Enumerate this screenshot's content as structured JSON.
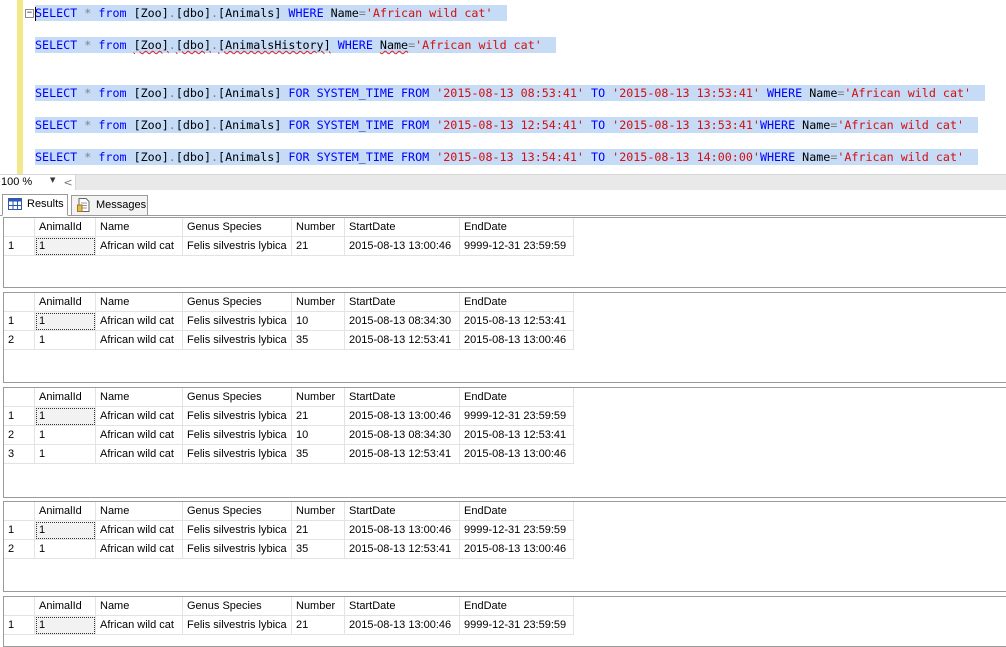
{
  "editor": {
    "queries": [
      {
        "parts": [
          {
            "t": "kw",
            "v": "SELECT"
          },
          {
            "t": "id",
            "v": " "
          },
          {
            "t": "op",
            "v": "*"
          },
          {
            "t": "id",
            "v": " "
          },
          {
            "t": "kw",
            "v": "from"
          },
          {
            "t": "id",
            "v": " [Zoo]"
          },
          {
            "t": "op",
            "v": "."
          },
          {
            "t": "id",
            "v": "[dbo]"
          },
          {
            "t": "op",
            "v": "."
          },
          {
            "t": "id",
            "v": "[Animals] "
          },
          {
            "t": "kw",
            "v": "WHERE"
          },
          {
            "t": "id",
            "v": " Name"
          },
          {
            "t": "op",
            "v": "="
          },
          {
            "t": "str",
            "v": "'African wild cat'"
          }
        ]
      },
      {
        "parts": [
          {
            "t": "kw",
            "v": "SELECT"
          },
          {
            "t": "id",
            "v": " "
          },
          {
            "t": "op",
            "v": "*"
          },
          {
            "t": "id",
            "v": " "
          },
          {
            "t": "kw",
            "v": "from"
          },
          {
            "t": "id",
            "v": " "
          },
          {
            "t": "sq",
            "v": "[Zoo]"
          },
          {
            "t": "op",
            "v": "."
          },
          {
            "t": "sq",
            "v": "[dbo]"
          },
          {
            "t": "op",
            "v": "."
          },
          {
            "t": "sq",
            "v": "[AnimalsHistory]"
          },
          {
            "t": "id",
            "v": " "
          },
          {
            "t": "kw",
            "v": "WHERE"
          },
          {
            "t": "id",
            "v": " "
          },
          {
            "t": "sq",
            "v": "Name"
          },
          {
            "t": "op",
            "v": "="
          },
          {
            "t": "str",
            "v": "'African wild cat'"
          }
        ]
      },
      {
        "parts": [
          {
            "t": "kw",
            "v": "SELECT"
          },
          {
            "t": "id",
            "v": " "
          },
          {
            "t": "op",
            "v": "*"
          },
          {
            "t": "id",
            "v": " "
          },
          {
            "t": "kw",
            "v": "from"
          },
          {
            "t": "id",
            "v": " [Zoo]"
          },
          {
            "t": "op",
            "v": "."
          },
          {
            "t": "id",
            "v": "[dbo]"
          },
          {
            "t": "op",
            "v": "."
          },
          {
            "t": "id",
            "v": "[Animals] "
          },
          {
            "t": "kw",
            "v": "FOR SYSTEM_TIME FROM"
          },
          {
            "t": "id",
            "v": " "
          },
          {
            "t": "str",
            "v": "'2015-08-13 08:53:41'"
          },
          {
            "t": "id",
            "v": " "
          },
          {
            "t": "kw",
            "v": "TO"
          },
          {
            "t": "id",
            "v": " "
          },
          {
            "t": "str",
            "v": "'2015-08-13 13:53:41'"
          },
          {
            "t": "id",
            "v": " "
          },
          {
            "t": "kw",
            "v": "WHERE"
          },
          {
            "t": "id",
            "v": " Name"
          },
          {
            "t": "op",
            "v": "="
          },
          {
            "t": "str",
            "v": "'African wild cat'"
          }
        ]
      },
      {
        "parts": [
          {
            "t": "kw",
            "v": "SELECT"
          },
          {
            "t": "id",
            "v": " "
          },
          {
            "t": "op",
            "v": "*"
          },
          {
            "t": "id",
            "v": " "
          },
          {
            "t": "kw",
            "v": "from"
          },
          {
            "t": "id",
            "v": " [Zoo]"
          },
          {
            "t": "op",
            "v": "."
          },
          {
            "t": "id",
            "v": "[dbo]"
          },
          {
            "t": "op",
            "v": "."
          },
          {
            "t": "id",
            "v": "[Animals] "
          },
          {
            "t": "kw",
            "v": "FOR SYSTEM_TIME FROM"
          },
          {
            "t": "id",
            "v": " "
          },
          {
            "t": "str",
            "v": "'2015-08-13 12:54:41'"
          },
          {
            "t": "id",
            "v": " "
          },
          {
            "t": "kw",
            "v": "TO"
          },
          {
            "t": "id",
            "v": " "
          },
          {
            "t": "str",
            "v": "'2015-08-13 13:53:41'"
          },
          {
            "t": "kw",
            "v": "WHERE"
          },
          {
            "t": "id",
            "v": " Name"
          },
          {
            "t": "op",
            "v": "="
          },
          {
            "t": "str",
            "v": "'African wild cat'"
          }
        ]
      },
      {
        "parts": [
          {
            "t": "kw",
            "v": "SELECT"
          },
          {
            "t": "id",
            "v": " "
          },
          {
            "t": "op",
            "v": "*"
          },
          {
            "t": "id",
            "v": " "
          },
          {
            "t": "kw",
            "v": "from"
          },
          {
            "t": "id",
            "v": " [Zoo]"
          },
          {
            "t": "op",
            "v": "."
          },
          {
            "t": "id",
            "v": "[dbo]"
          },
          {
            "t": "op",
            "v": "."
          },
          {
            "t": "id",
            "v": "[Animals] "
          },
          {
            "t": "kw",
            "v": "FOR SYSTEM_TIME FROM"
          },
          {
            "t": "id",
            "v": " "
          },
          {
            "t": "str",
            "v": "'2015-08-13 13:54:41'"
          },
          {
            "t": "id",
            "v": " "
          },
          {
            "t": "kw",
            "v": "TO"
          },
          {
            "t": "id",
            "v": " "
          },
          {
            "t": "str",
            "v": "'2015-08-13 14:00:00'"
          },
          {
            "t": "kw",
            "v": "WHERE"
          },
          {
            "t": "id",
            "v": " Name"
          },
          {
            "t": "op",
            "v": "="
          },
          {
            "t": "str",
            "v": "'African wild cat'"
          }
        ]
      }
    ],
    "fold_symbol": "−"
  },
  "statusbar": {
    "zoom": "100 %",
    "scroll_left": "<"
  },
  "tabs": {
    "results_label": "Results",
    "messages_label": "Messages"
  },
  "grid_columns": [
    "AnimalId",
    "Name",
    "Genus Species",
    "Number",
    "StartDate",
    "EndDate"
  ],
  "result_sets": [
    {
      "rows": [
        {
          "n": "1",
          "cells": [
            "1",
            "African wild cat",
            "Felis silvestris lybica",
            "21",
            "2015-08-13 13:00:46",
            "9999-12-31 23:59:59"
          ]
        }
      ]
    },
    {
      "rows": [
        {
          "n": "1",
          "cells": [
            "1",
            "African wild cat",
            "Felis silvestris lybica",
            "10",
            "2015-08-13 08:34:30",
            "2015-08-13 12:53:41"
          ]
        },
        {
          "n": "2",
          "cells": [
            "1",
            "African wild cat",
            "Felis silvestris lybica",
            "35",
            "2015-08-13 12:53:41",
            "2015-08-13 13:00:46"
          ]
        }
      ]
    },
    {
      "rows": [
        {
          "n": "1",
          "cells": [
            "1",
            "African wild cat",
            "Felis silvestris lybica",
            "21",
            "2015-08-13 13:00:46",
            "9999-12-31 23:59:59"
          ]
        },
        {
          "n": "2",
          "cells": [
            "1",
            "African wild cat",
            "Felis silvestris lybica",
            "10",
            "2015-08-13 08:34:30",
            "2015-08-13 12:53:41"
          ]
        },
        {
          "n": "3",
          "cells": [
            "1",
            "African wild cat",
            "Felis silvestris lybica",
            "35",
            "2015-08-13 12:53:41",
            "2015-08-13 13:00:46"
          ]
        }
      ]
    },
    {
      "rows": [
        {
          "n": "1",
          "cells": [
            "1",
            "African wild cat",
            "Felis silvestris lybica",
            "21",
            "2015-08-13 13:00:46",
            "9999-12-31 23:59:59"
          ]
        },
        {
          "n": "2",
          "cells": [
            "1",
            "African wild cat",
            "Felis silvestris lybica",
            "35",
            "2015-08-13 12:53:41",
            "2015-08-13 13:00:46"
          ]
        }
      ]
    },
    {
      "rows": [
        {
          "n": "1",
          "cells": [
            "1",
            "African wild cat",
            "Felis silvestris lybica",
            "21",
            "2015-08-13 13:00:46",
            "9999-12-31 23:59:59"
          ]
        }
      ]
    }
  ],
  "colors": {
    "keyword": "#0000ff",
    "string": "#d60f0f",
    "operator": "#808080",
    "selection": "#c5dbf6",
    "changebar": "#f3e98a"
  },
  "icons": {
    "results_tab": "grid-icon",
    "messages_tab": "document-icon"
  }
}
